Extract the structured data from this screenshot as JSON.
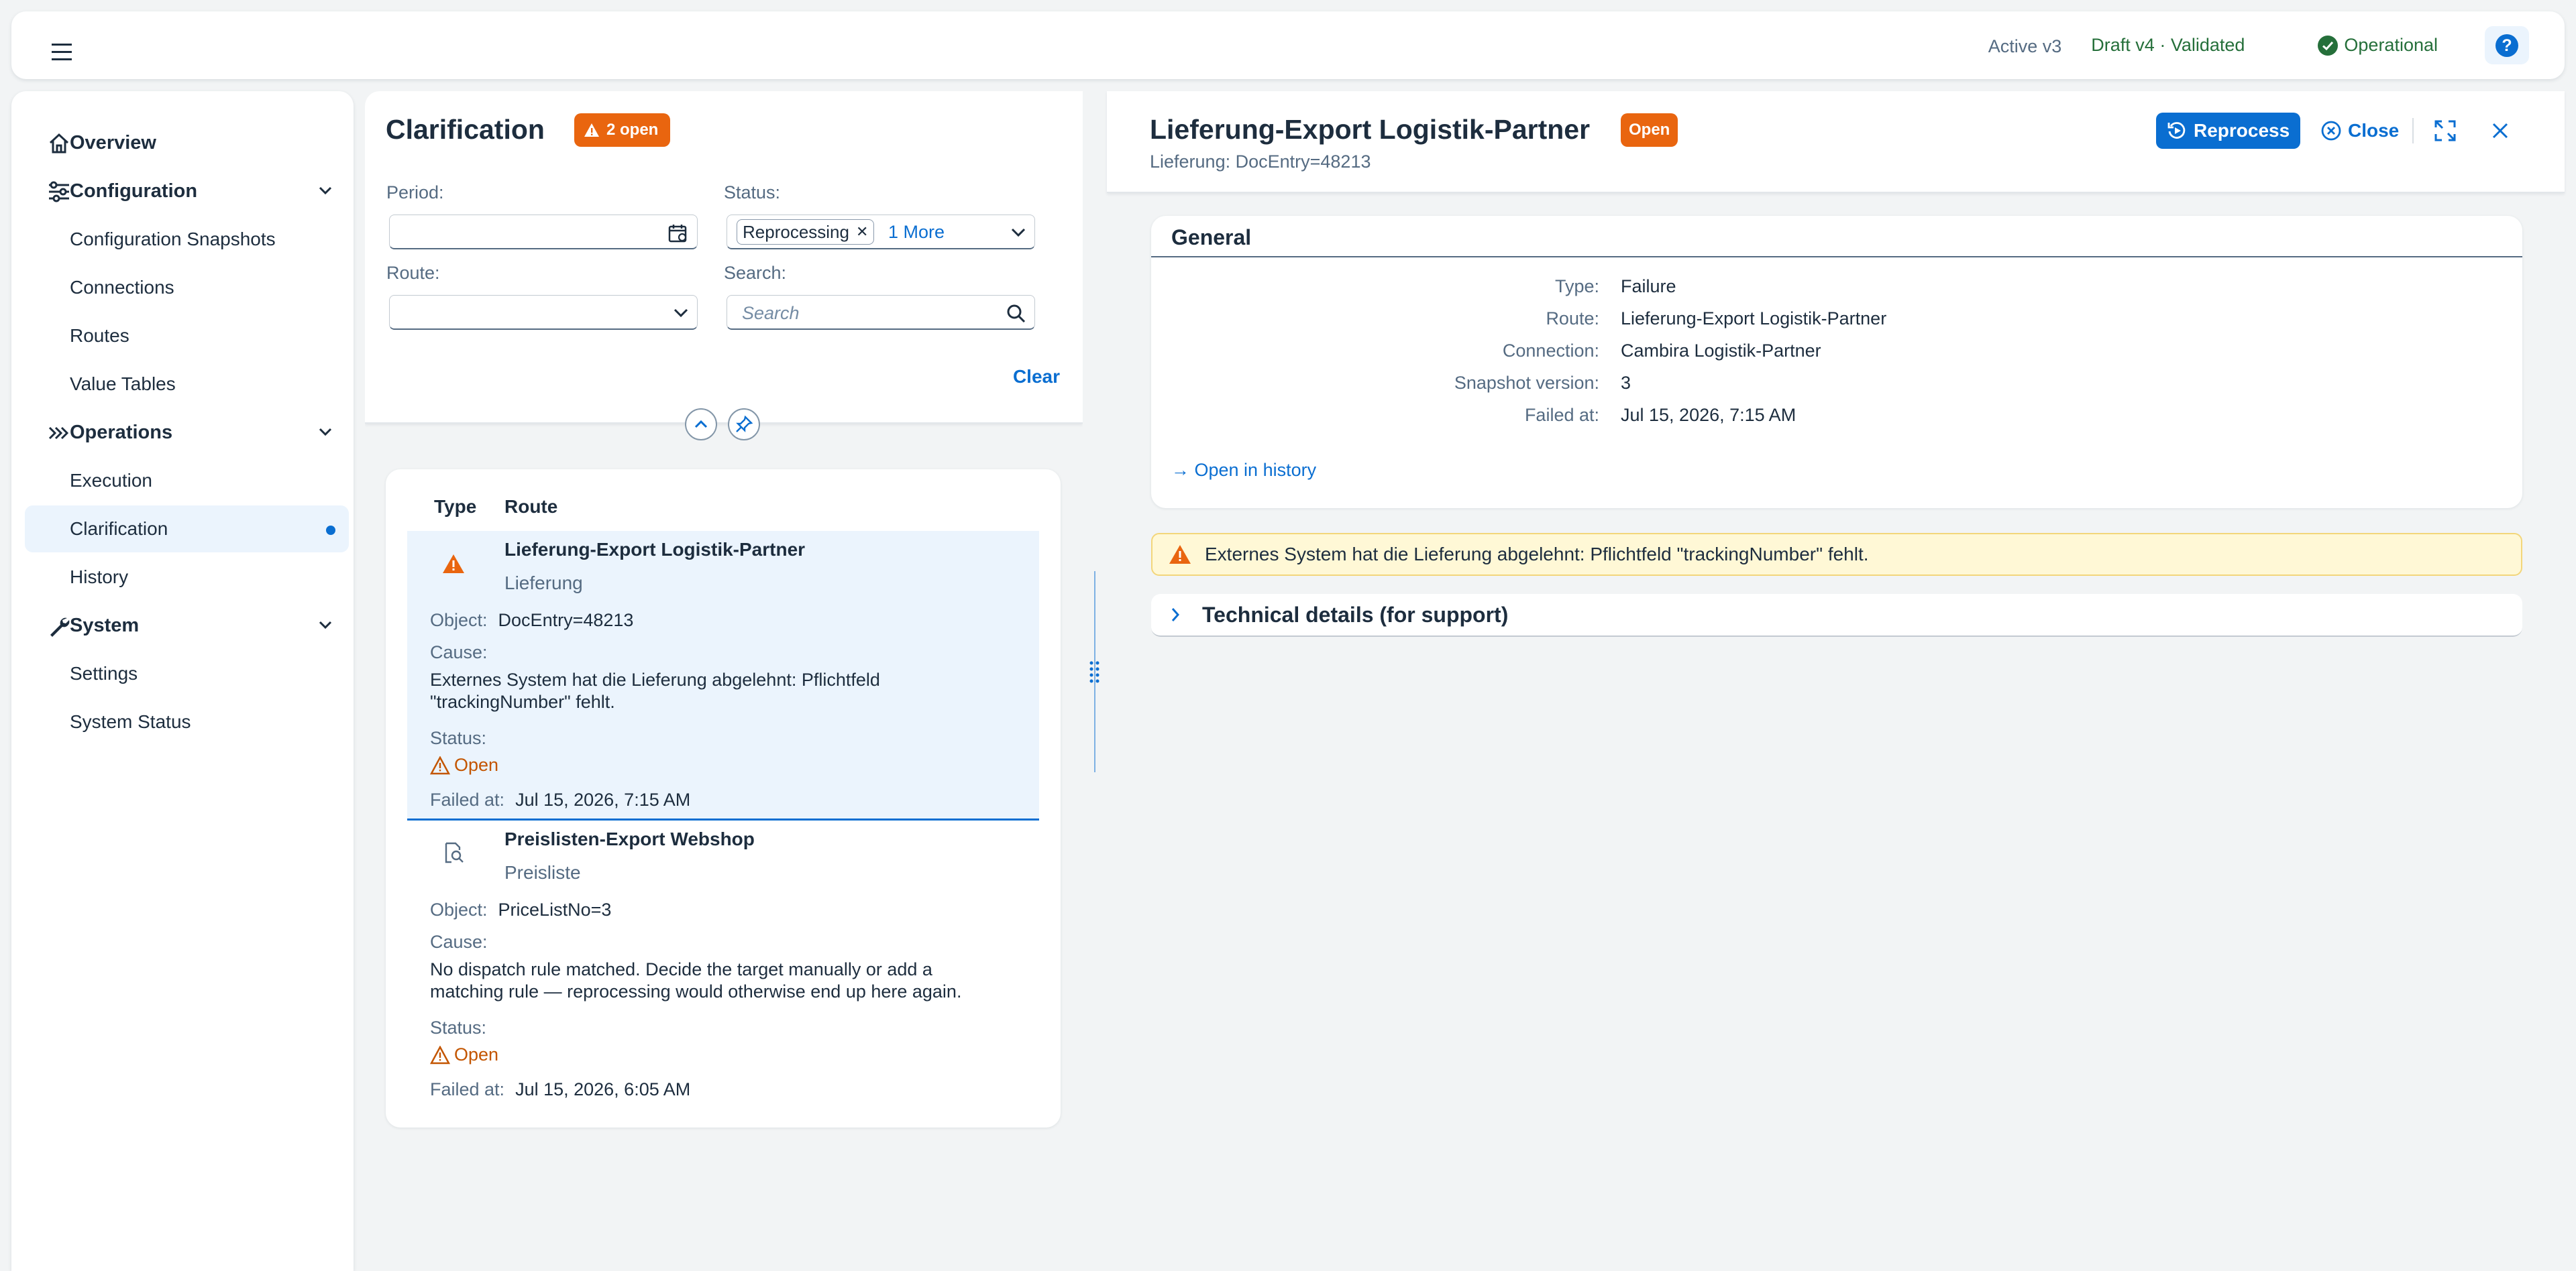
{
  "shell": {
    "active_version": "Active v3",
    "draft_version": "Draft v4 · Validated",
    "status": "Operational",
    "help_label": "?"
  },
  "sidebar": {
    "items": [
      {
        "label": "Overview",
        "icon": "home-icon"
      },
      {
        "label": "Configuration",
        "icon": "sliders-icon",
        "expanded": true
      },
      {
        "label": "Configuration Snapshots"
      },
      {
        "label": "Connections"
      },
      {
        "label": "Routes"
      },
      {
        "label": "Value Tables"
      },
      {
        "label": "Operations",
        "icon": "chevrons-right-icon",
        "expanded": true
      },
      {
        "label": "Execution"
      },
      {
        "label": "Clarification",
        "selected": true
      },
      {
        "label": "History"
      },
      {
        "label": "System",
        "icon": "wrench-icon",
        "expanded": true
      },
      {
        "label": "Settings"
      },
      {
        "label": "System Status"
      }
    ]
  },
  "clarification": {
    "title": "Clarification",
    "badge": "2 open",
    "filters": {
      "period_label": "Period:",
      "period_value": "",
      "status_label": "Status:",
      "status_token": "Reprocessing",
      "status_more": "1 More",
      "route_label": "Route:",
      "route_value": "",
      "search_label": "Search:",
      "search_placeholder": "Search",
      "clear_label": "Clear"
    },
    "table": {
      "col_type": "Type",
      "col_route": "Route",
      "object_label": "Object:",
      "cause_label": "Cause:",
      "status_label": "Status:",
      "failed_label": "Failed at:",
      "rows": [
        {
          "title": "Lieferung-Export Logistik-Partner",
          "subtitle": "Lieferung",
          "object": "DocEntry=48213",
          "cause": "Externes System hat die Lieferung abgelehnt: Pflichtfeld \"trackingNumber\" fehlt.",
          "status": "Open",
          "failed_at": "Jul 15, 2026, 7:15 AM",
          "icon": "warning-icon"
        },
        {
          "title": "Preislisten-Export Webshop",
          "subtitle": "Preisliste",
          "object": "PriceListNo=3",
          "cause": "No dispatch rule matched. Decide the target manually or add a matching rule — reprocessing would otherwise end up here again.",
          "status": "Open",
          "failed_at": "Jul 15, 2026, 6:05 AM",
          "icon": "document-search-icon"
        }
      ]
    }
  },
  "detail": {
    "title": "Lieferung-Export Logistik-Partner",
    "badge": "Open",
    "subtitle": "Lieferung: DocEntry=48213",
    "reprocess_label": "Reprocess",
    "close_label": "Close",
    "general": {
      "title": "General",
      "fields": [
        {
          "key": "Type:",
          "value": "Failure"
        },
        {
          "key": "Route:",
          "value": "Lieferung-Export Logistik-Partner"
        },
        {
          "key": "Connection:",
          "value": "Cambira Logistik-Partner"
        },
        {
          "key": "Snapshot version:",
          "value": "3"
        },
        {
          "key": "Failed at:",
          "value": "Jul 15, 2026, 7:15 AM"
        }
      ],
      "history_link": "→ Open in history"
    },
    "message": "Externes System hat die Lieferung abgelehnt: Pflichtfeld \"trackingNumber\" fehlt.",
    "technical_title": "Technical details (for support)"
  },
  "colors": {
    "accent": "#0a6ed1",
    "warning": "#e9650f",
    "success": "#256f3a",
    "selection": "#ebf4fd"
  }
}
